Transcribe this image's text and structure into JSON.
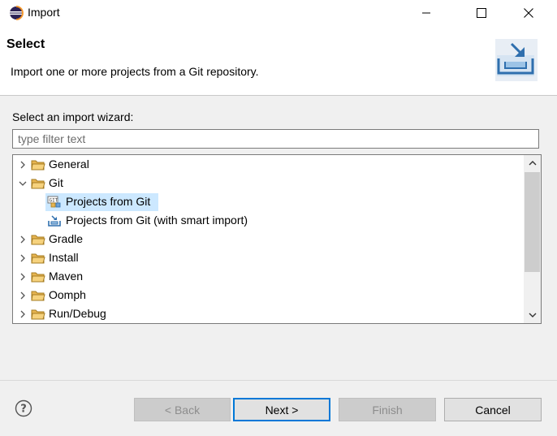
{
  "window": {
    "title": "Import",
    "icon": "eclipse-icon"
  },
  "header": {
    "title": "Select",
    "description": "Import one or more projects from a Git repository.",
    "graphic": "import-wizard-icon"
  },
  "wizard_list": {
    "label": "Select an import wizard:",
    "filter_placeholder": "type filter text",
    "filter_value": "",
    "items": [
      {
        "label": "General",
        "icon": "folder-icon",
        "level": 0,
        "expanded": false
      },
      {
        "label": "Git",
        "icon": "folder-icon",
        "level": 0,
        "expanded": true
      },
      {
        "label": "Projects from Git",
        "icon": "git-projects-icon",
        "level": 1,
        "selected": true
      },
      {
        "label": "Projects from Git (with smart import)",
        "icon": "smart-import-icon",
        "level": 1
      },
      {
        "label": "Gradle",
        "icon": "folder-icon",
        "level": 0,
        "expanded": false
      },
      {
        "label": "Install",
        "icon": "folder-icon",
        "level": 0,
        "expanded": false
      },
      {
        "label": "Maven",
        "icon": "folder-icon",
        "level": 0,
        "expanded": false
      },
      {
        "label": "Oomph",
        "icon": "folder-icon",
        "level": 0,
        "expanded": false
      },
      {
        "label": "Run/Debug",
        "icon": "folder-icon",
        "level": 0,
        "expanded": false
      }
    ]
  },
  "buttons": {
    "back": "< Back",
    "next": "Next >",
    "finish": "Finish",
    "cancel": "Cancel"
  },
  "colors": {
    "selection": "#cce8ff",
    "default_button_border": "#0078d7",
    "folder": "#e6b450"
  }
}
